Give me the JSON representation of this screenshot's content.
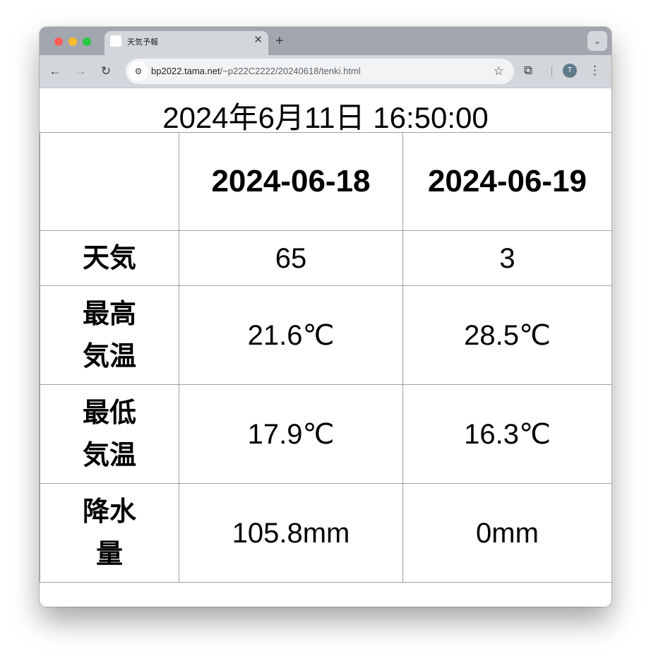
{
  "browser": {
    "tab": {
      "title": "天気予報",
      "close": "✕"
    },
    "new_tab": "+",
    "tab_menu": "⌄",
    "nav": {
      "back": "←",
      "forward": "→",
      "reload": "↻"
    },
    "url_host": "bp2022.tama.net",
    "url_path": "/~p222C2222/20240618/tenki.html",
    "avatar_letter": "T"
  },
  "page": {
    "datetime": "2024年6月11日 16:50:00",
    "table": {
      "columns": [
        "",
        "2024-06-18",
        "2024-06-19"
      ],
      "rows": [
        {
          "label": "天気",
          "values": [
            "65",
            "3"
          ]
        },
        {
          "label": "最高気温",
          "values": [
            "21.6℃",
            "28.5℃"
          ]
        },
        {
          "label": "最低気温",
          "values": [
            "17.9℃",
            "16.3℃"
          ]
        },
        {
          "label": "降水量",
          "values": [
            "105.8mm",
            "0mm"
          ]
        }
      ]
    }
  }
}
